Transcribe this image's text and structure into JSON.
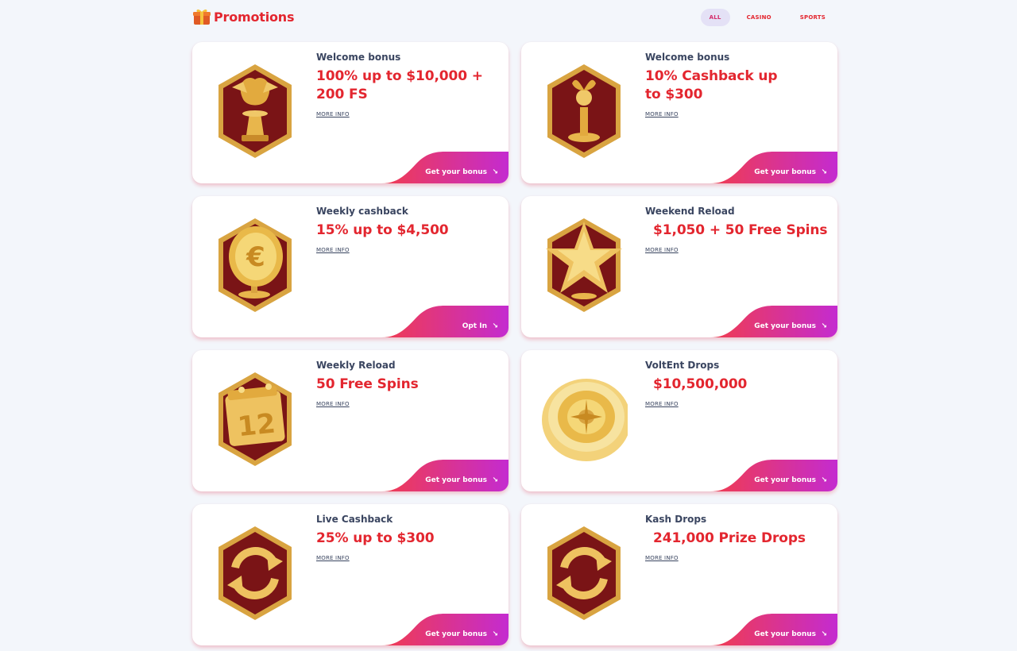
{
  "header": {
    "title": "Promotions",
    "tabs": [
      {
        "label": "ALL",
        "active": true
      },
      {
        "label": "CASINO",
        "active": false
      },
      {
        "label": "SPORTS",
        "active": false
      }
    ]
  },
  "cards": [
    {
      "kicker": "Welcome bonus",
      "offer": "100% up to $10,000 + 200 FS",
      "more": "MORE INFO",
      "cta": "Get your bonus",
      "icon": "winged-lion-trophy-icon"
    },
    {
      "kicker": "Welcome bonus",
      "offer": "10% Cashback up to $300",
      "more": "MORE INFO",
      "cta": "Get your bonus",
      "icon": "statuette-trophy-icon"
    },
    {
      "kicker": "Weekly cashback",
      "offer": "15% up to $4,500",
      "more": "MORE INFO",
      "cta": "Opt In",
      "icon": "euro-coin-icon"
    },
    {
      "kicker": "Weekend Reload",
      "offer": "$1,050 + 50 Free Spins",
      "more": "MORE INFO",
      "cta": "Get your bonus",
      "icon": "star-icon"
    },
    {
      "kicker": "Weekly Reload",
      "offer": "50 Free Spins",
      "more": "MORE INFO",
      "cta": "Get your bonus",
      "icon": "calendar-icon"
    },
    {
      "kicker": "VoltEnt Drops",
      "offer": "$10,500,000",
      "more": "MORE INFO",
      "cta": "Get your bonus",
      "icon": "roulette-wheel-icon"
    },
    {
      "kicker": "Live Cashback",
      "offer": "25% up to $300",
      "more": "MORE INFO",
      "cta": "Get your bonus",
      "icon": "refresh-arrows-icon"
    },
    {
      "kicker": "Kash Drops",
      "offer": "241,000 Prize Drops",
      "more": "MORE INFO",
      "cta": "Get your bonus",
      "icon": "refresh-arrows-icon"
    }
  ],
  "colors": {
    "accent": "#e3262f",
    "cta_start": "#f13c4e",
    "cta_end": "#c42bd0",
    "hex_gold": "#d9a441",
    "hex_inner": "#7a1416"
  }
}
